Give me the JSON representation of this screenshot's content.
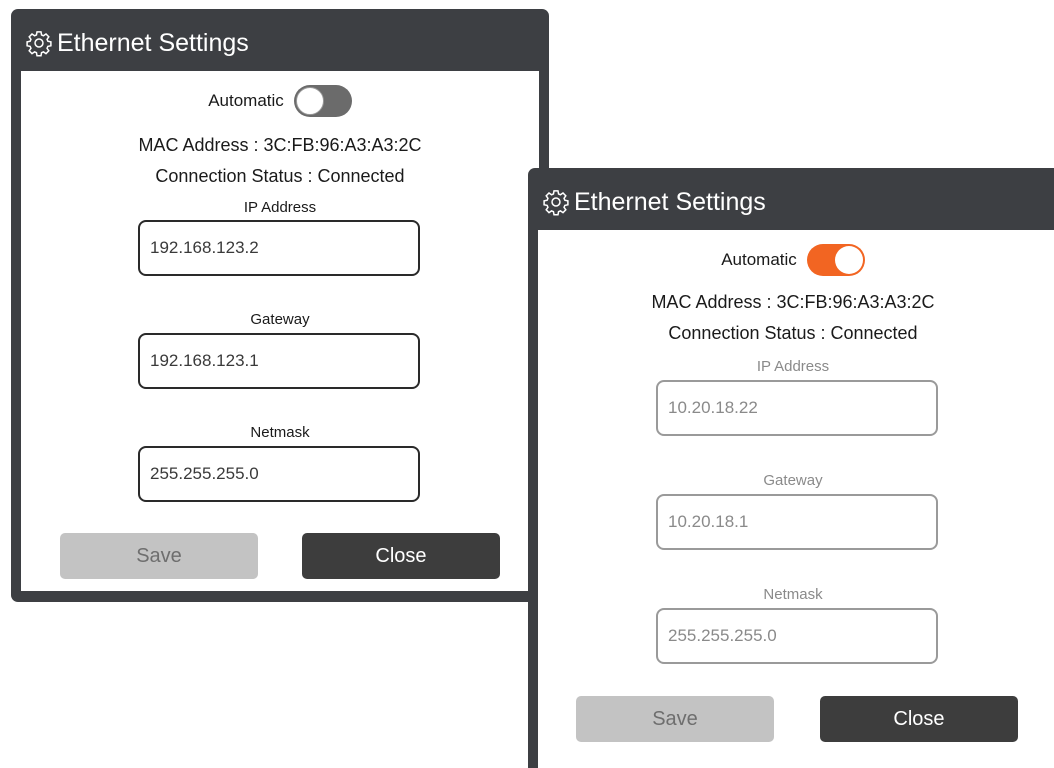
{
  "dialog_left": {
    "title": "Ethernet Settings",
    "automatic_label": "Automatic",
    "automatic_on": false,
    "mac_address": "MAC Address : 3C:FB:96:A3:A3:2C",
    "connection_status": "Connection Status : Connected",
    "ip_label": "IP Address",
    "ip_value": "192.168.123.2",
    "gateway_label": "Gateway",
    "gateway_value": "192.168.123.1",
    "netmask_label": "Netmask",
    "netmask_value": "255.255.255.0",
    "save_label": "Save",
    "close_label": "Close"
  },
  "dialog_right": {
    "title": "Ethernet Settings",
    "automatic_label": "Automatic",
    "automatic_on": true,
    "mac_address": "MAC Address : 3C:FB:96:A3:A3:2C",
    "connection_status": "Connection Status : Connected",
    "ip_label": "IP Address",
    "ip_value": "10.20.18.22",
    "gateway_label": "Gateway",
    "gateway_value": "10.20.18.1",
    "netmask_label": "Netmask",
    "netmask_value": "255.255.255.0",
    "save_label": "Save",
    "close_label": "Close"
  },
  "colors": {
    "frame": "#3d3f43",
    "toggle_on": "#f26522",
    "toggle_off": "#6b6b6b",
    "save_disabled": "#c3c3c3",
    "close_button": "#3d3d3d"
  }
}
